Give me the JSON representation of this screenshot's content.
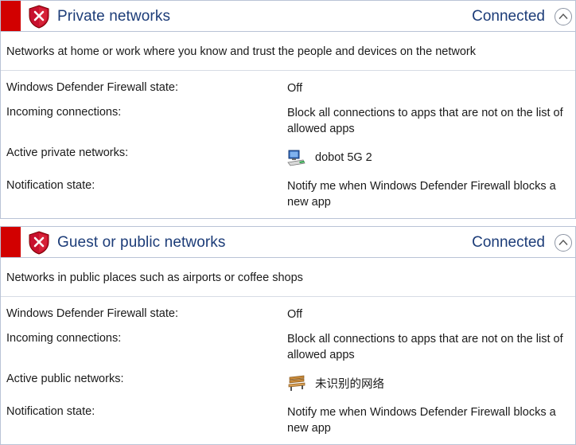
{
  "private": {
    "title": "Private networks",
    "status": "Connected",
    "description": "Networks at home or work where you know and trust the people and devices on the network",
    "firewall_label": "Windows Defender Firewall state:",
    "firewall_value": "Off",
    "incoming_label": "Incoming connections:",
    "incoming_value": "Block all connections to apps that are not on the list of allowed apps",
    "active_label": "Active private networks:",
    "active_value": "dobot 5G 2",
    "active_icon": "network-computer-icon",
    "notification_label": "Notification state:",
    "notification_value": "Notify me when Windows Defender Firewall blocks a new app"
  },
  "public": {
    "title": "Guest or public networks",
    "status": "Connected",
    "description": "Networks in public places such as airports or coffee shops",
    "firewall_label": "Windows Defender Firewall state:",
    "firewall_value": "Off",
    "incoming_label": "Incoming connections:",
    "incoming_value": "Block all connections to apps that are not on the list of allowed apps",
    "active_label": "Active public networks:",
    "active_value": "未识别的网络",
    "active_icon": "park-bench-icon",
    "notification_label": "Notification state:",
    "notification_value": "Notify me when Windows Defender Firewall blocks a new app"
  },
  "colors": {
    "accent_red": "#d20000",
    "title_blue": "#1c3c78",
    "border": "#b9c3d6"
  }
}
